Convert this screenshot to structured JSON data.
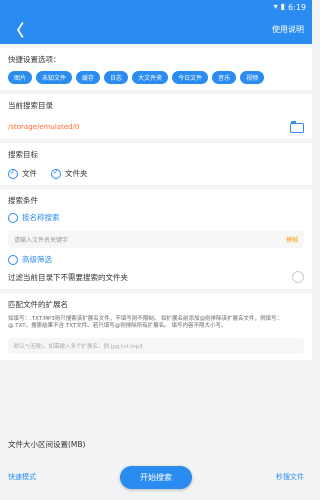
{
  "status": {
    "time": "6:19"
  },
  "appbar": {
    "back": "〈",
    "help": "使用说明"
  },
  "quick": {
    "label": "快捷设置选项：",
    "chips": [
      "图片",
      "未知文件",
      "缓存",
      "日志",
      "大文件夹",
      "今日文件",
      "音乐",
      "视频"
    ]
  },
  "current_dir": {
    "label": "当前搜索目录",
    "value": "/storage/emulated/0"
  },
  "target": {
    "label": "搜索目标",
    "options": [
      "文件",
      "文件夹"
    ]
  },
  "condition": {
    "label": "搜索条件",
    "name_search": "按名称搜索",
    "placeholder": "请输入文件名关键字",
    "query": "模糊"
  },
  "advanced": {
    "label": "高级筛选",
    "skip_label": "过滤当前目录下不需要搜索的文件夹"
  },
  "ext": {
    "label": "匹配文件的扩展名",
    "desc": "如填写：.TXT.MP3则只搜索该扩展名文件，不填写则不限制。\n如扩展名前添加@则排除该扩展名文件，例填写：@.TXT，搜索结果不含.TXT文件。若只填写@则排除所有扩展名。\n填写内容不限大小写。",
    "placeholder": "默认*(无限)，如需输入多个扩展名，例.jpg.txt.mp3"
  },
  "size": {
    "label": "文件大小区间设置(MB)"
  },
  "bottom": {
    "left": "快速模式",
    "start": "开始搜索",
    "right": "秒搜文件"
  }
}
